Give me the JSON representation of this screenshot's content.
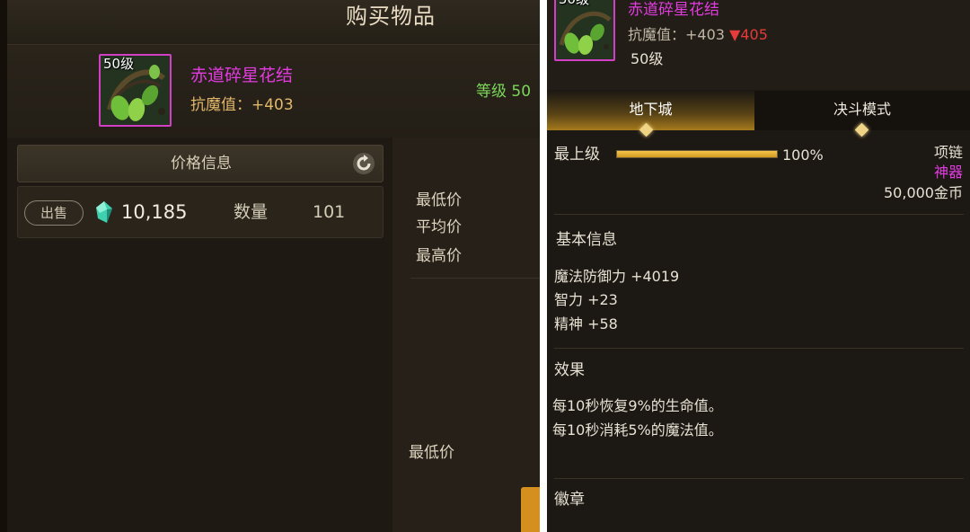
{
  "left": {
    "title": "购买物品",
    "item": {
      "level_badge": "50级",
      "name": "赤道碎星花结",
      "stat": "抗魔值：+403",
      "level_label": "等级 50"
    },
    "price_header": "价格信息",
    "sell": {
      "button": "出售",
      "price": "10,185",
      "qty_label": "数量",
      "qty_value": "101"
    },
    "price_labels": {
      "min": "最低价",
      "avg": "平均价",
      "max": "最高价",
      "min2": "最低价"
    }
  },
  "right": {
    "item": {
      "level_badge": "50级",
      "name": "赤道碎星花结",
      "stat_prefix": "抗魔值：+403",
      "stat_compare": "▼405",
      "level": "50级"
    },
    "tabs": [
      "地下城",
      "决斗模式"
    ],
    "grade": {
      "label": "最上级",
      "progress": 1.0,
      "progress_text": "100%"
    },
    "type": "项链",
    "rarity": "神器",
    "price": "50,000金币",
    "basic_info": {
      "title": "基本信息",
      "lines": [
        "魔法防御力 +4019",
        "智力 +23",
        "精神 +58"
      ]
    },
    "effects": {
      "title": "效果",
      "lines": [
        "每10秒恢复9%的生命值。",
        "每10秒消耗5%的魔法值。"
      ]
    },
    "emblem": {
      "title": "徽章"
    }
  },
  "colors": {
    "rarity_magenta": "#e23be0",
    "level_green": "#7bd65a",
    "down_red": "#e53b3b",
    "accent_gold": "#f0c44a"
  },
  "icons": [
    "refresh-icon",
    "gem-icon",
    "item-icon"
  ]
}
